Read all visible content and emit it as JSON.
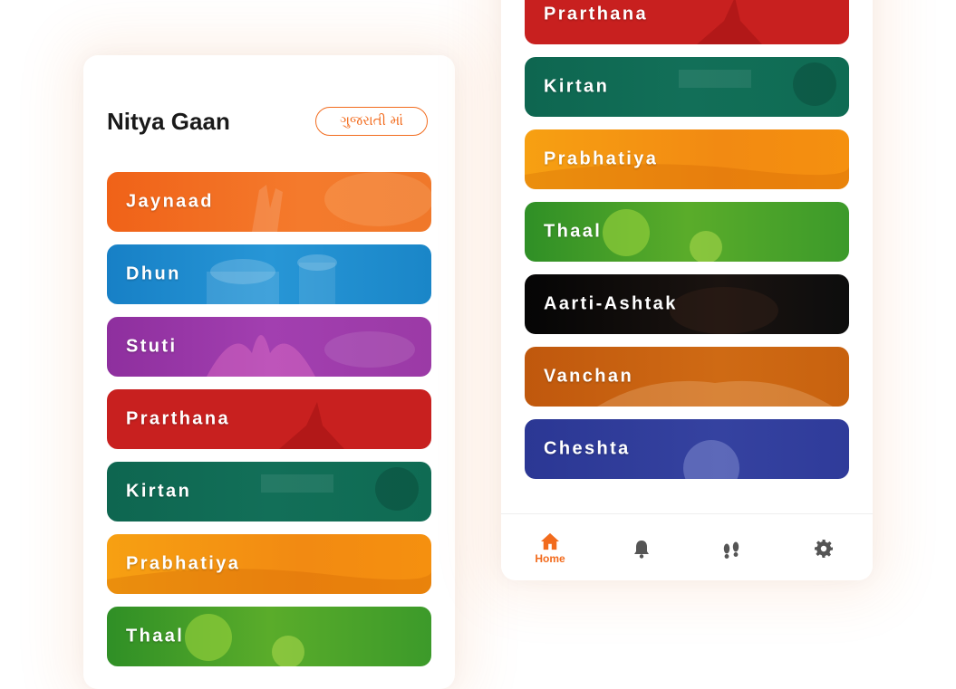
{
  "header": {
    "title": "Nitya Gaan",
    "language_button": "ગુજરાતી માં"
  },
  "left_categories": [
    {
      "label": "Jaynaad",
      "color": "#f26b1d"
    },
    {
      "label": "Dhun",
      "color": "#1a86c8"
    },
    {
      "label": "Stuti",
      "color": "#9b3aa6"
    },
    {
      "label": "Prarthana",
      "color": "#c8201f"
    },
    {
      "label": "Kirtan",
      "color": "#0f6b53"
    },
    {
      "label": "Prabhatiya",
      "color": "#f5900f"
    },
    {
      "label": "Thaal",
      "color": "#3c9a2a"
    }
  ],
  "right_categories": [
    {
      "label": "Prarthana",
      "color": "#c8201f"
    },
    {
      "label": "Kirtan",
      "color": "#0f6b53"
    },
    {
      "label": "Prabhatiya",
      "color": "#f5900f"
    },
    {
      "label": "Thaal",
      "color": "#3c9a2a"
    },
    {
      "label": "Aarti-Ashtak",
      "color": "#0d0d0d"
    },
    {
      "label": "Vanchan",
      "color": "#c8620f"
    },
    {
      "label": "Cheshta",
      "color": "#2f3b9a"
    }
  ],
  "bottom_nav": {
    "home_label": "Home",
    "items": [
      "home-icon",
      "bell-icon",
      "footprints-icon",
      "gear-icon"
    ],
    "active_color": "#f26b1d",
    "inactive_color": "#555555"
  }
}
